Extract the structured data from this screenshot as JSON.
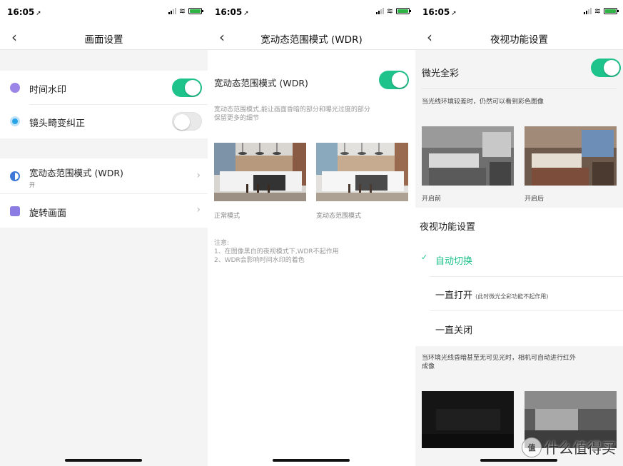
{
  "status": {
    "time": "16:05",
    "location_icon": "location-arrow-icon"
  },
  "screen1": {
    "title": "画面设置",
    "rows": [
      {
        "label": "时间水印",
        "icon": "clock-icon",
        "toggle": "on"
      },
      {
        "label": "镜头畸变纠正",
        "icon": "lens-icon",
        "toggle": "off"
      }
    ],
    "wdr": {
      "label": "宽动态范围模式 (WDR)",
      "value": "开"
    },
    "rotate": {
      "label": "旋转画面"
    }
  },
  "screen2": {
    "title": "宽动态范围模式 (WDR)",
    "switch_label": "宽动态范围模式 (WDR)",
    "desc_line1": "宽动态范围模式,能让画面昏暗的部分和曝光过度的部分",
    "desc_line2": "保留更多的细节",
    "caption_left": "正常模式",
    "caption_right": "宽动态范围模式",
    "note_title": "注意:",
    "note_1": "1、在图像黑白的夜视模式下,WDR不起作用",
    "note_2": "2、WDR会影响时间水印的着色"
  },
  "screen3": {
    "title": "夜视功能设置",
    "switch_label": "微光全彩",
    "hint": "当光线环境较差时，仍然可以看到彩色图像",
    "caption_before": "开启前",
    "caption_after": "开启后",
    "section_title": "夜视功能设置",
    "options": [
      {
        "label": "自动切换",
        "selected": true
      },
      {
        "label": "一直打开",
        "note": "(此时微光全彩功能不起作用)",
        "selected": false
      },
      {
        "label": "一直关闭",
        "selected": false
      }
    ],
    "ir_hint_1": "当环境光线昏暗甚至无可见光时，相机可自动进行红外",
    "ir_hint_2": "成像"
  },
  "watermark": {
    "badge": "值",
    "text": "什么值得买"
  },
  "colors": {
    "accent": "#1ec28b",
    "clock_icon": "#9b86e8",
    "lens_icon": "#2aa4e8",
    "wdr_icon": "#3c79d8",
    "rotate_icon": "#8b7ce4"
  }
}
